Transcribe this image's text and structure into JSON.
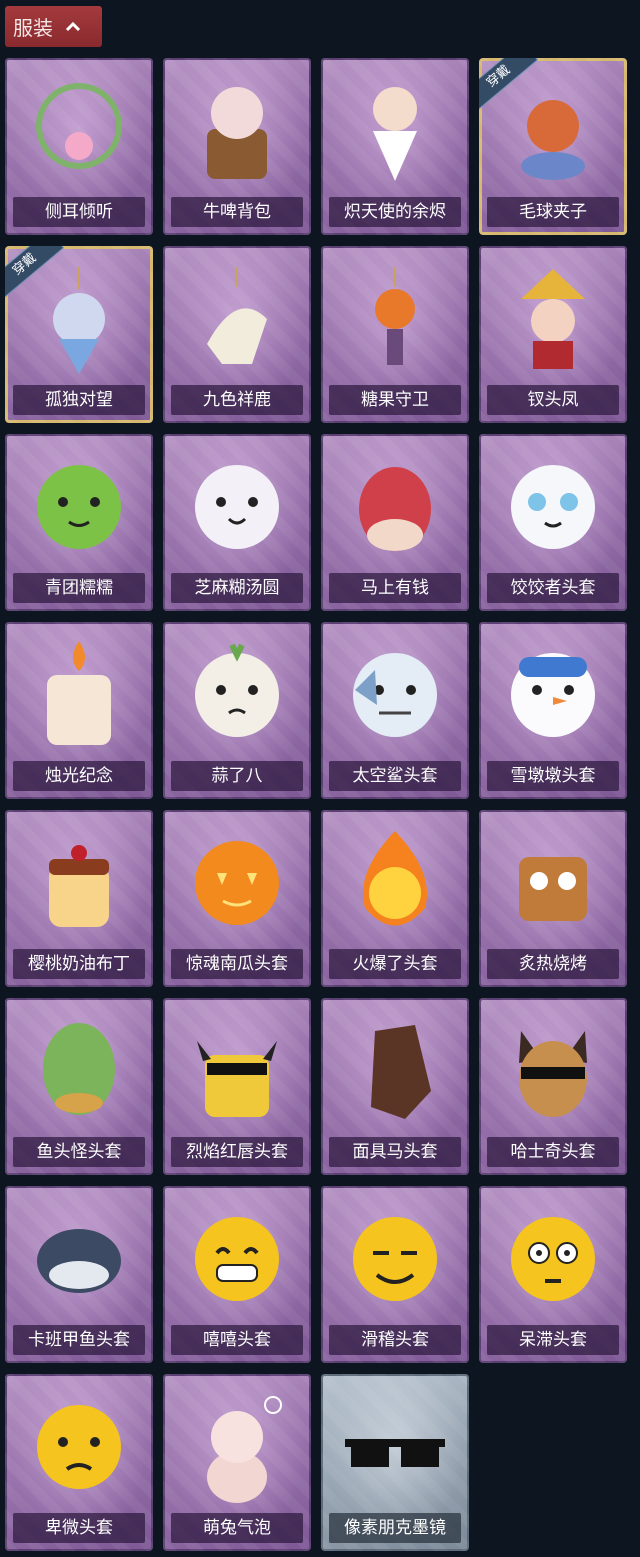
{
  "header": {
    "tab_label": "服装"
  },
  "items": [
    {
      "name": "侧耳倾听",
      "icon": "flower-wreath-icon",
      "worn": false,
      "grey": false
    },
    {
      "name": "牛啤背包",
      "icon": "cow-barrel-icon",
      "worn": false,
      "grey": false
    },
    {
      "name": "炽天使的余烬",
      "icon": "angel-doll-icon",
      "worn": false,
      "grey": false
    },
    {
      "name": "毛球夹子",
      "icon": "raccoon-drum-icon",
      "worn": true,
      "grey": false
    },
    {
      "name": "孤独对望",
      "icon": "fairy-charm-icon",
      "worn": true,
      "grey": false
    },
    {
      "name": "九色祥鹿",
      "icon": "deer-charm-icon",
      "worn": false,
      "grey": false
    },
    {
      "name": "糖果守卫",
      "icon": "pumpkin-scarecrow-icon",
      "worn": false,
      "grey": false
    },
    {
      "name": "钗头凤",
      "icon": "phoenix-crown-doll-icon",
      "worn": false,
      "grey": false
    },
    {
      "name": "青团糯糯",
      "icon": "green-dumpling-head-icon",
      "worn": false,
      "grey": false
    },
    {
      "name": "芝麻糊汤圆",
      "icon": "rice-ball-head-icon",
      "worn": false,
      "grey": false
    },
    {
      "name": "马上有钱",
      "icon": "red-horse-head-icon",
      "worn": false,
      "grey": false
    },
    {
      "name": "饺饺者头套",
      "icon": "dumpling-head-icon",
      "worn": false,
      "grey": false
    },
    {
      "name": "烛光纪念",
      "icon": "candle-head-icon",
      "worn": false,
      "grey": false
    },
    {
      "name": "蒜了八",
      "icon": "garlic-head-icon",
      "worn": false,
      "grey": false
    },
    {
      "name": "太空鲨头套",
      "icon": "shark-head-icon",
      "worn": false,
      "grey": false
    },
    {
      "name": "雪墩墩头套",
      "icon": "snowman-head-icon",
      "worn": false,
      "grey": false
    },
    {
      "name": "樱桃奶油布丁",
      "icon": "pudding-head-icon",
      "worn": false,
      "grey": false
    },
    {
      "name": "惊魂南瓜头套",
      "icon": "pumpkin-head-icon",
      "worn": false,
      "grey": false
    },
    {
      "name": "火爆了头套",
      "icon": "fire-head-icon",
      "worn": false,
      "grey": false
    },
    {
      "name": "炙热烧烤",
      "icon": "bbq-head-icon",
      "worn": false,
      "grey": false
    },
    {
      "name": "鱼头怪头套",
      "icon": "fish-monster-head-icon",
      "worn": false,
      "grey": false
    },
    {
      "name": "烈焰红唇头套",
      "icon": "yellow-mouse-head-icon",
      "worn": false,
      "grey": false
    },
    {
      "name": "面具马头套",
      "icon": "horse-mask-icon",
      "worn": false,
      "grey": false
    },
    {
      "name": "哈士奇头套",
      "icon": "husky-head-icon",
      "worn": false,
      "grey": false
    },
    {
      "name": "卡班甲鱼头套",
      "icon": "whale-head-icon",
      "worn": false,
      "grey": false
    },
    {
      "name": "嘻嘻头套",
      "icon": "grin-emoji-head-icon",
      "worn": false,
      "grey": false
    },
    {
      "name": "滑稽头套",
      "icon": "smirk-emoji-head-icon",
      "worn": false,
      "grey": false
    },
    {
      "name": "呆滞头套",
      "icon": "stunned-emoji-head-icon",
      "worn": false,
      "grey": false
    },
    {
      "name": "卑微头套",
      "icon": "humble-emoji-head-icon",
      "worn": false,
      "grey": false
    },
    {
      "name": "萌兔气泡",
      "icon": "bunny-bubble-icon",
      "worn": false,
      "grey": false
    },
    {
      "name": "像素朋克墨镜",
      "icon": "pixel-sunglasses-icon",
      "worn": false,
      "grey": true
    }
  ],
  "worn_badge": "穿戴"
}
